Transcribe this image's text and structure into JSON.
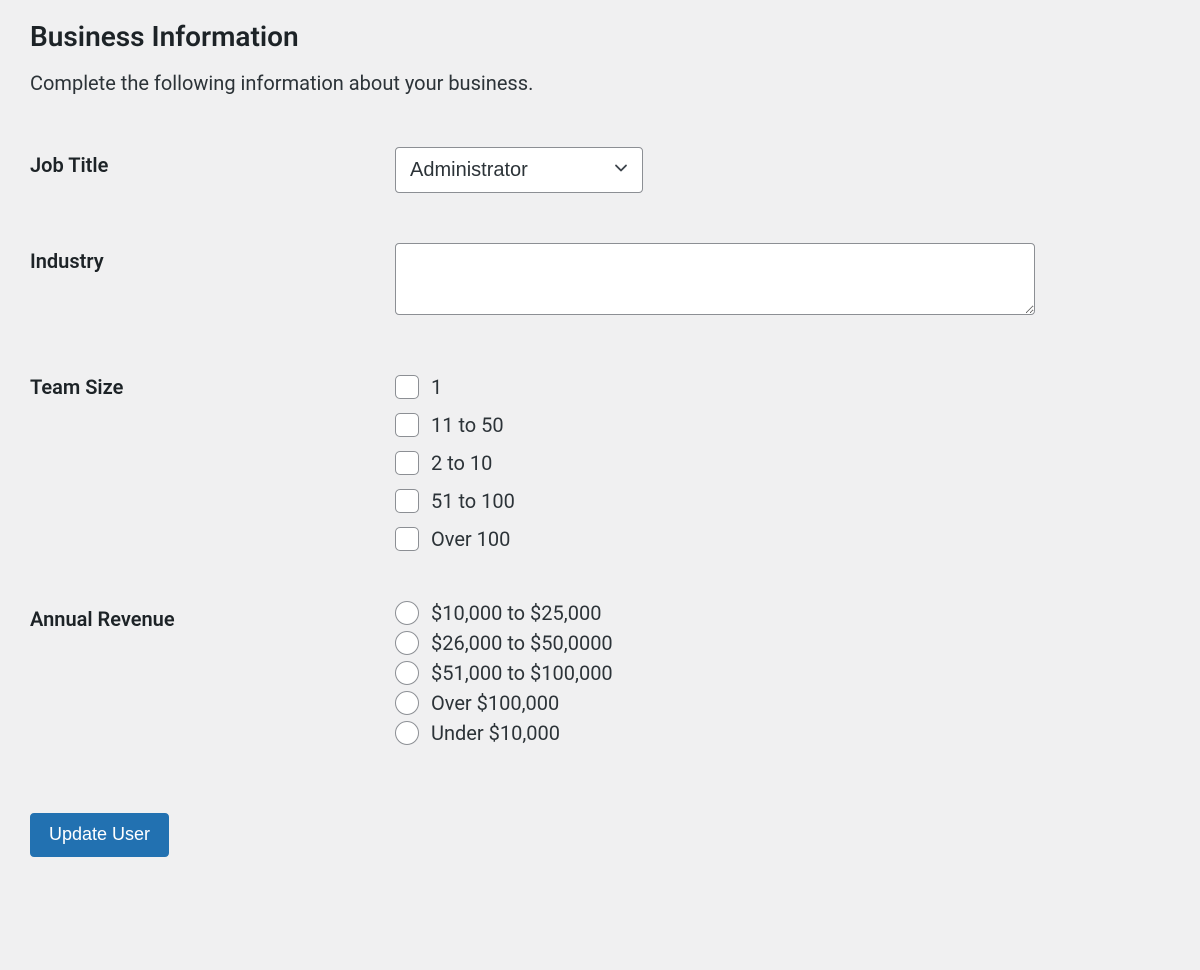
{
  "section": {
    "title": "Business Information",
    "description": "Complete the following information about your business."
  },
  "fields": {
    "job_title": {
      "label": "Job Title",
      "value": "Administrator"
    },
    "industry": {
      "label": "Industry",
      "value": ""
    },
    "team_size": {
      "label": "Team Size",
      "options": [
        "1",
        "11 to 50",
        "2 to 10",
        "51 to 100",
        "Over 100"
      ]
    },
    "annual_revenue": {
      "label": "Annual Revenue",
      "options": [
        "$10,000 to $25,000",
        "$26,000 to $50,0000",
        "$51,000 to $100,000",
        "Over $100,000",
        "Under $10,000"
      ]
    }
  },
  "actions": {
    "submit_label": "Update User"
  }
}
